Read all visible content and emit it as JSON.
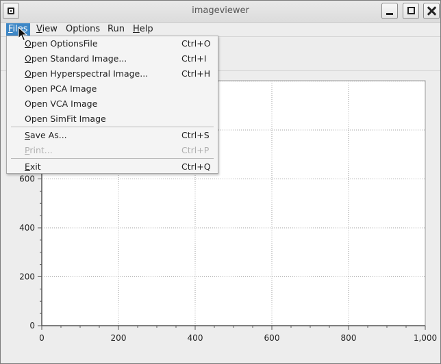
{
  "window": {
    "title": "imageviewer"
  },
  "menubar": {
    "items": [
      {
        "label": "Files",
        "mnemonic": "F",
        "rest": "iles",
        "active": true
      },
      {
        "label": "View",
        "mnemonic": "V",
        "rest": "iew"
      },
      {
        "label": "Options",
        "mnemonic": "",
        "rest": "Options"
      },
      {
        "label": "Run",
        "mnemonic": "",
        "rest": "Run"
      },
      {
        "label": "Help",
        "mnemonic": "H",
        "rest": "elp"
      }
    ]
  },
  "files_menu": {
    "items": [
      {
        "m": "O",
        "rest": "pen OptionsFile",
        "shortcut": "Ctrl+O",
        "enabled": true
      },
      {
        "m": "O",
        "rest": "pen Standard Image...",
        "shortcut": "Ctrl+I",
        "enabled": true
      },
      {
        "m": "O",
        "rest": "pen Hyperspectral Image...",
        "shortcut": "Ctrl+H",
        "enabled": true
      },
      {
        "m": "",
        "rest": "Open PCA Image",
        "shortcut": "",
        "enabled": true
      },
      {
        "m": "",
        "rest": "Open VCA Image",
        "shortcut": "",
        "enabled": true
      },
      {
        "m": "",
        "rest": "Open SimFit Image",
        "shortcut": "",
        "enabled": true
      },
      {
        "m": "S",
        "rest": "ave As...",
        "shortcut": "Ctrl+S",
        "enabled": true
      },
      {
        "m": "P",
        "rest": "rint...",
        "shortcut": "Ctrl+P",
        "enabled": false
      },
      {
        "m": "E",
        "rest": "xit",
        "shortcut": "Ctrl+Q",
        "enabled": true
      }
    ]
  },
  "plot": {
    "x_ticks": [
      "0",
      "200",
      "400",
      "600",
      "800",
      "1,000"
    ],
    "y_ticks": [
      "0",
      "200",
      "400",
      "600"
    ],
    "xlim": [
      0,
      1000
    ],
    "ylim": [
      0,
      1000
    ],
    "grid": true,
    "grid_color": "#a0a0a0"
  },
  "colors": {
    "menu_highlight": "#3d87c6",
    "plot_background": "#ffffff"
  }
}
